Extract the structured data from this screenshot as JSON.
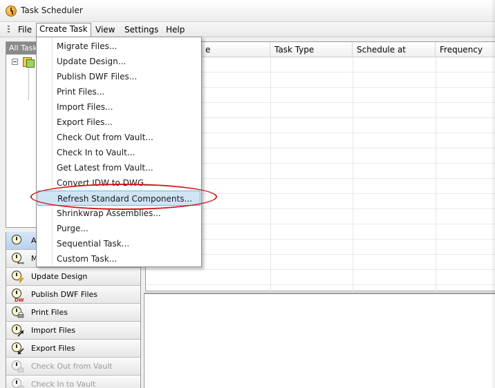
{
  "window": {
    "title": "Task Scheduler"
  },
  "menubar": {
    "file": "File",
    "create_task": "Create Task",
    "view": "View",
    "settings": "Settings",
    "help": "Help"
  },
  "tree": {
    "header": "All Tasks"
  },
  "grid": {
    "columns": [
      "e",
      "Task Type",
      "Schedule at",
      "Frequency"
    ]
  },
  "dropdown": {
    "items": [
      "Migrate Files...",
      "Update Design...",
      "Publish DWF Files...",
      "Print Files...",
      "Import Files...",
      "Export Files...",
      "Check Out from Vault...",
      "Check In to Vault...",
      "Get Latest from Vault...",
      "Convert IDW to DWG...",
      "Refresh Standard Components...",
      "Shrinkwrap Assemblies...",
      "Purge...",
      "Sequential Task...",
      "Custom Task..."
    ],
    "highlighted_index": 10
  },
  "task_list": {
    "items": [
      {
        "label": "A",
        "icon": "clock-icon",
        "state": "selected"
      },
      {
        "label": "M",
        "icon": "migrate-icon",
        "state": "normal"
      },
      {
        "label": "Update Design",
        "icon": "lightning-icon",
        "state": "normal"
      },
      {
        "label": "Publish DWF Files",
        "icon": "dwf-icon",
        "state": "normal"
      },
      {
        "label": "Print Files",
        "icon": "printer-icon",
        "state": "normal"
      },
      {
        "label": "Import Files",
        "icon": "import-arrow-icon",
        "state": "normal"
      },
      {
        "label": "Export Files",
        "icon": "export-arrow-icon",
        "state": "normal"
      },
      {
        "label": "Check Out from Vault",
        "icon": "vault-checkout-icon",
        "state": "disabled"
      },
      {
        "label": "Check In to Vault",
        "icon": "vault-checkin-icon",
        "state": "disabled"
      }
    ]
  },
  "colors": {
    "highlight": "#cfe5f6",
    "annotation": "#d01515"
  }
}
